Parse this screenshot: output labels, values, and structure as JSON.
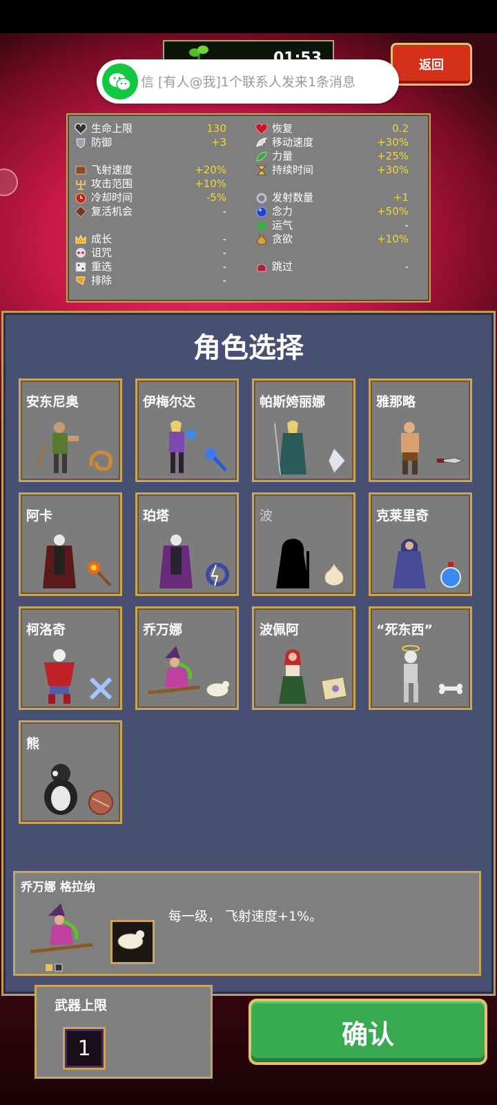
{
  "colors": {
    "accent_gold": "#c9a65c",
    "stat_value": "#f2d540",
    "confirm_green": "#3aaa52",
    "back_red": "#d4301a",
    "panel_blue": "#475073",
    "card_grey": "#7c7c7c"
  },
  "header": {
    "timer": "01:53",
    "back_label": "返回"
  },
  "notification": {
    "text": "信  [有人@我]1个联系人发来1条消息",
    "icon": "wechat-icon"
  },
  "stats": {
    "left": [
      {
        "label": "生命上限",
        "value": "130",
        "icon": "heart-outline-icon"
      },
      {
        "label": "防御",
        "value": "+3",
        "icon": "armor-icon"
      },
      {
        "label": "飞射速度",
        "value": "+20%",
        "icon": "book-icon"
      },
      {
        "label": "攻击范围",
        "value": "+10%",
        "icon": "candelabra-icon"
      },
      {
        "label": "冷却时间",
        "value": "-5%",
        "icon": "clock-icon"
      },
      {
        "label": "复活机会",
        "value": "-",
        "icon": "revive-icon"
      },
      {
        "label": "成长",
        "value": "-",
        "icon": "crown-icon"
      },
      {
        "label": "诅咒",
        "value": "-",
        "icon": "skull-icon"
      },
      {
        "label": "重选",
        "value": "-",
        "icon": "dice-icon"
      },
      {
        "label": "排除",
        "value": "-",
        "icon": "banish-icon"
      }
    ],
    "right": [
      {
        "label": "恢复",
        "value": "0.2",
        "icon": "heart-icon"
      },
      {
        "label": "移动速度",
        "value": "+30%",
        "icon": "wing-icon"
      },
      {
        "label": "力量",
        "value": "+25%",
        "icon": "leaf-icon"
      },
      {
        "label": "持续时间",
        "value": "+30%",
        "icon": "hourglass-icon"
      },
      {
        "label": "发射数量",
        "value": "+1",
        "icon": "ring-icon"
      },
      {
        "label": "念力",
        "value": "+50%",
        "icon": "orb-icon"
      },
      {
        "label": "运气",
        "value": "-",
        "icon": "clover-icon"
      },
      {
        "label": "贪欲",
        "value": "+10%",
        "icon": "moneybag-icon"
      },
      {
        "label": "跳过",
        "value": "-",
        "icon": "skip-icon"
      }
    ]
  },
  "main": {
    "title": "角色选择",
    "characters": [
      {
        "name": "安东尼奥",
        "weapon": "whip-icon"
      },
      {
        "name": "伊梅尔达",
        "weapon": "magic-wand-icon"
      },
      {
        "name": "帕斯姱丽娜",
        "weapon": "knife-crystal-icon"
      },
      {
        "name": "雅那略",
        "weapon": "knife-icon"
      },
      {
        "name": "阿卡",
        "weapon": "fire-wand-icon"
      },
      {
        "name": "珀塔",
        "weapon": "lightning-ring-icon"
      },
      {
        "name": "波",
        "weapon": "garlic-icon"
      },
      {
        "name": "克莱里奇",
        "weapon": "holy-water-icon"
      },
      {
        "name": "柯洛奇",
        "weapon": "cross-icon"
      },
      {
        "name": "乔万娜",
        "weapon": "peachone-icon"
      },
      {
        "name": "波佩阿",
        "weapon": "spellbook-icon"
      },
      {
        "name": "“死东西”",
        "weapon": "bone-icon"
      },
      {
        "name": "熊",
        "weapon": "shield-icon"
      }
    ]
  },
  "selected": {
    "name": "乔万娜 格拉纳",
    "description": "每一级， 飞射速度+1%。"
  },
  "weapon_limit": {
    "label": "武器上限",
    "value": "1"
  },
  "confirm_label": "确认"
}
